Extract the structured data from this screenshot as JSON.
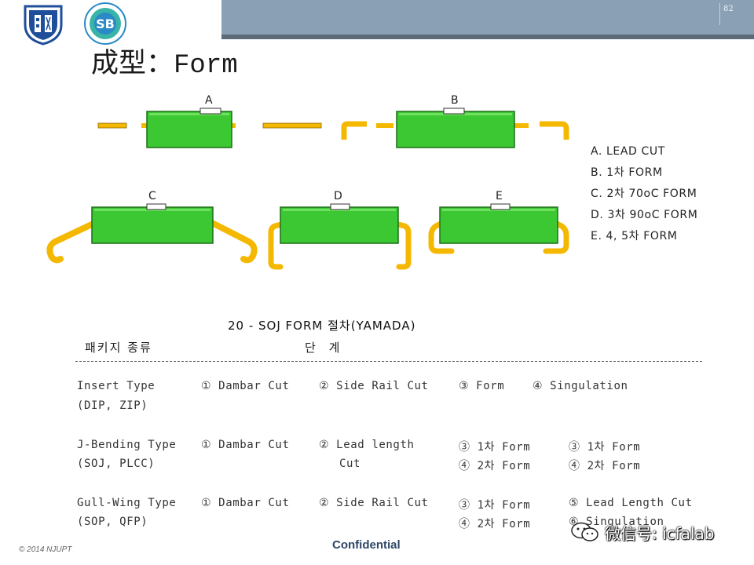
{
  "header": {
    "page_number": "82",
    "logo_left_icon": "university-crest-icon",
    "logo_right_icon": "school-badge-icon",
    "bar_color": "#8aa0b4"
  },
  "title": {
    "zh": "成型：",
    "en": "Form"
  },
  "diagram": {
    "labels": [
      "A",
      "B",
      "C",
      "D",
      "E"
    ],
    "body_color": "#3cc832",
    "lead_color": "#f5b800"
  },
  "legend": [
    "A. LEAD CUT",
    "B. 1차 FORM",
    "C. 2차 70oC FORM",
    "D. 3차 90oC FORM",
    "E. 4, 5차 FORM"
  ],
  "table": {
    "title": "20 - SOJ FORM 절차(YAMADA)",
    "header_type": "패키지 종류",
    "header_step": "단 계",
    "rows": [
      {
        "type": "Insert Type",
        "sub": "(DIP, ZIP)",
        "c1": "① Dambar Cut",
        "c2": "② Side Rail Cut",
        "c3": "③ Form",
        "c4": "④ Singulation"
      },
      {
        "type": "J-Bending Type",
        "sub": "(SOJ, PLCC)",
        "c1": "① Dambar Cut",
        "c2": "② Lead length",
        "c2b": "Cut",
        "c3": "③ 1차 Form",
        "c3b": "④ 2차 Form",
        "c4": "③ 1차 Form",
        "c4b": "④ 2차 Form"
      },
      {
        "type": "Gull-Wing Type",
        "sub": "(SOP, QFP)",
        "c1": "① Dambar Cut",
        "c2": "② Side Rail Cut",
        "c3": "③ 1차 Form",
        "c3b": "④ 2차 Form",
        "c4": "⑤ Lead Length Cut",
        "c4b": "⑥ Singulation"
      }
    ]
  },
  "footer": {
    "copyright": "© 2014 NJUPT",
    "confidential": "Confidential",
    "wechat": "微信号: icfalab"
  }
}
